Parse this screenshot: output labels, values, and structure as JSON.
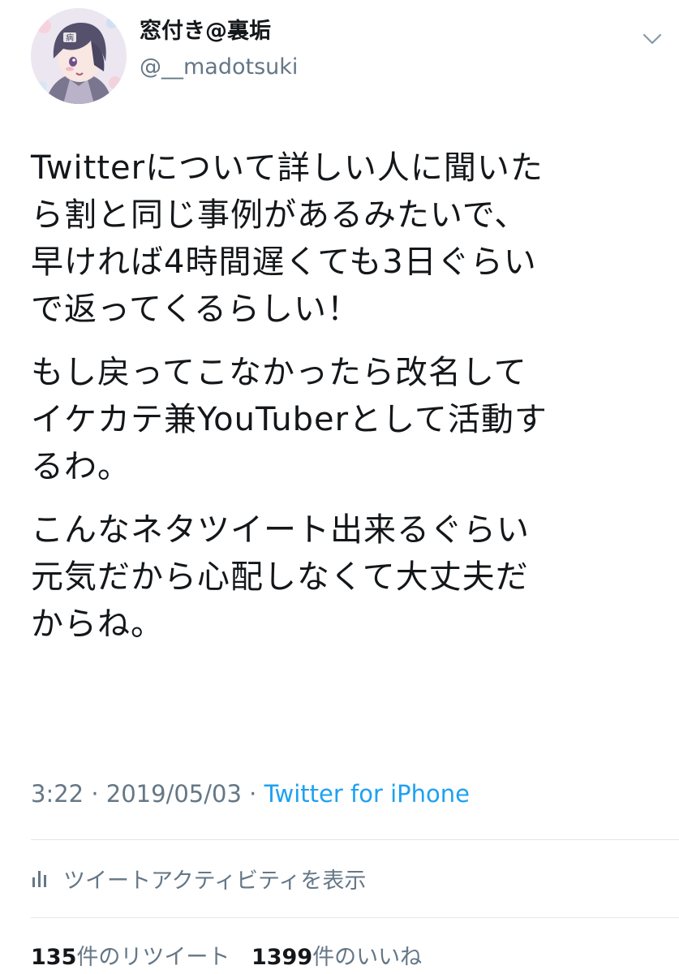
{
  "user": {
    "display_name": "窓付き@裏垢",
    "handle": "@__madotsuki",
    "avatar_icon": "user-avatar-image",
    "avatar_badge_text": "病"
  },
  "tweet": {
    "paragraphs": [
      "Twitterについて詳しい人に聞いた\nら割と同じ事例があるみたいで、\n早ければ4時間遅くても3日ぐらい\nで返ってくるらしい！",
      "もし戻ってこなかったら改名して\nイケカテ兼YouTuberとして活動す\nるわ。",
      "こんなネタツイート出来るぐらい\n元気だから心配しなくて大丈夫だ\nからね。"
    ],
    "time": "3:22",
    "date": "2019/05/03",
    "separator": "·",
    "source": "Twitter for iPhone"
  },
  "activity": {
    "icon": "bar-chart-icon",
    "label": "ツイートアクティビティを表示"
  },
  "stats": {
    "retweet_count": "135",
    "retweet_label": "件のリツイート",
    "like_count": "1399",
    "like_label": "件のいいね"
  },
  "menu": {
    "icon": "chevron-down-icon"
  },
  "colors": {
    "text": "#14171a",
    "secondary": "#657786",
    "link": "#1da1f2",
    "divider": "#e1e8ed"
  }
}
